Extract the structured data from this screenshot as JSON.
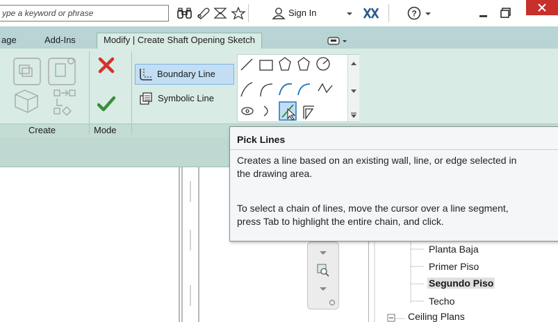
{
  "titlebar": {
    "search_placeholder": "ype a keyword or phrase",
    "sign_in_label": "Sign In",
    "icons": [
      "binoculars-icon",
      "communication-icon",
      "exchange-icon",
      "favorite-icon",
      "user-icon",
      "dropdown-icon",
      "exchange-apps-icon",
      "help-icon",
      "minimize-icon",
      "restore-icon",
      "close-icon"
    ]
  },
  "tabs": {
    "items": [
      "age",
      "Add-Ins"
    ],
    "active": "Modify | Create Shaft Opening Sketch"
  },
  "ribbon": {
    "create_caption": "Create",
    "mode_caption": "Mode",
    "boundary_line_label": "Boundary Line",
    "symbolic_line_label": "Symbolic Line"
  },
  "tooltip": {
    "title": "Pick Lines",
    "line1": "Creates a line based on an existing wall, line, or edge selected in",
    "line2": "the drawing area.",
    "line3": "To select a chain of lines, move the cursor over a line segment,",
    "line4": "press Tab to highlight the entire chain, and click."
  },
  "project_browser": {
    "items": [
      "Planta Baja",
      "Primer Piso",
      "Segundo Piso",
      "Techo",
      "Ceiling Plans"
    ],
    "selected": "Segundo Piso"
  },
  "colors": {
    "ribbon_bg": "#d8ebe4",
    "tab_bar": "#b8d4d4",
    "close_button": "#c7302b",
    "accent_green": "#3a8e3a",
    "cancel_red": "#d6312b",
    "selection_blue": "#c3def4"
  }
}
